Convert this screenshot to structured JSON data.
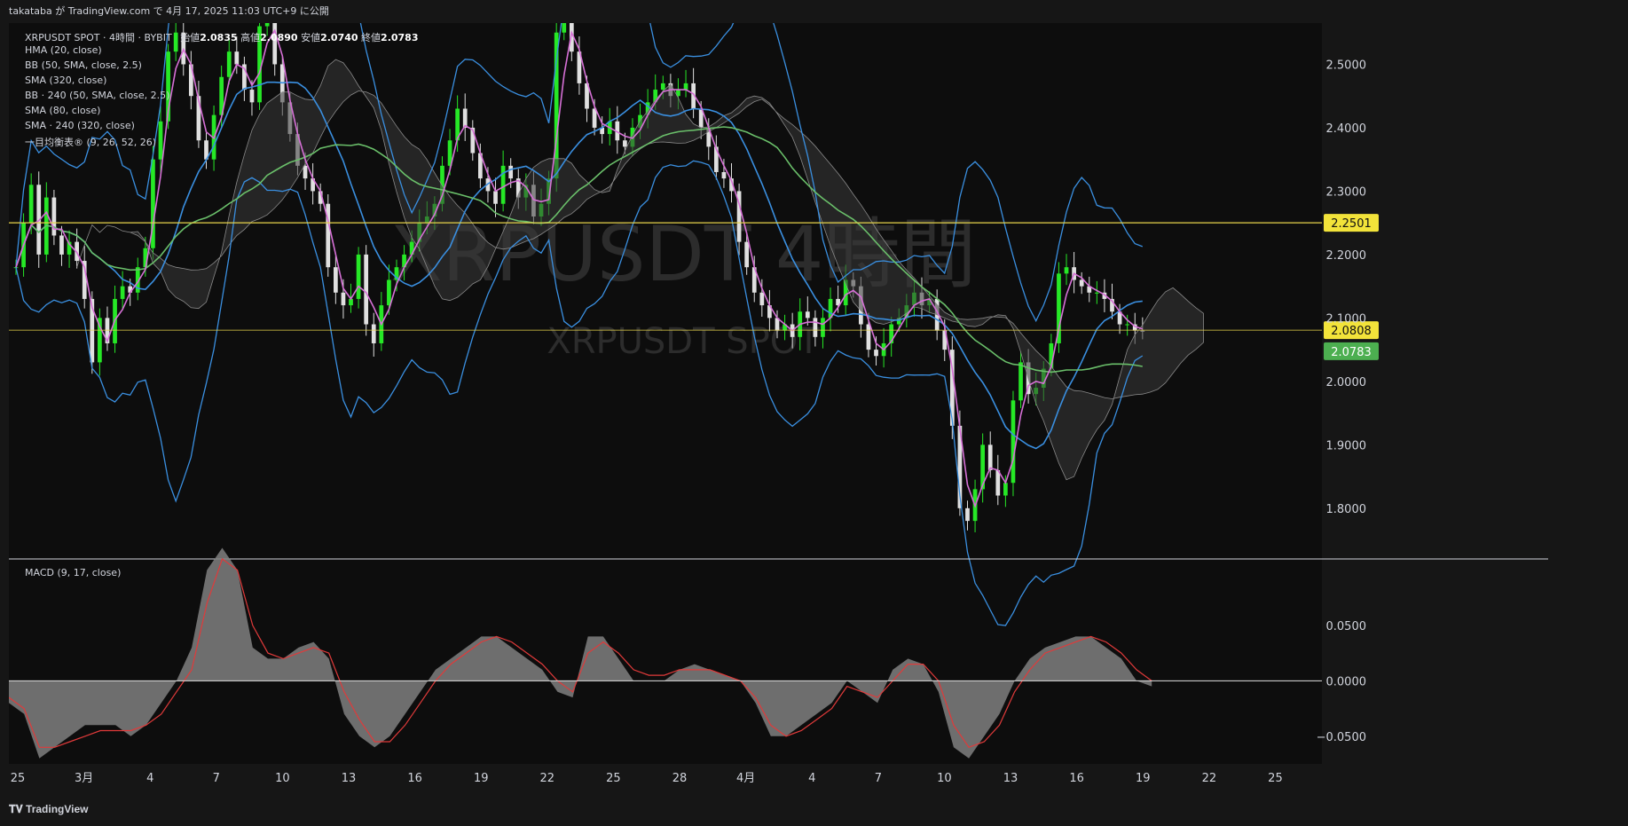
{
  "header": {
    "publish_text": "takataba が TradingView.com で 4月 17, 2025 11:03 UTC+9 に公開"
  },
  "legend": {
    "symbol_line": "XRPUSDT SPOT · 4時間 · BYBIT",
    "open_label": "始値",
    "open": "2.0835",
    "high_label": "高値",
    "high": "2.0890",
    "low_label": "安値",
    "low": "2.0740",
    "close_label": "終値",
    "close": "2.0783",
    "indicators": [
      "HMA (20, close)",
      "BB (50, SMA, close, 2.5)",
      "SMA (320, close)",
      "BB · 240 (50, SMA, close, 2.5)",
      "SMA (80, close)",
      "SMA · 240 (320, close)",
      "一目均衡表® (9, 26, 52, 26)"
    ],
    "macd": "MACD (9, 17, close)"
  },
  "watermark": {
    "big": "XRPUSDT 4時間",
    "small": "XRPUSDT SPOT"
  },
  "footer": {
    "brand": "TradingView"
  },
  "colors": {
    "up": "#26e826",
    "down": "#e0e0e0",
    "hma": "#d670d6",
    "bb": "#3a8fe0",
    "sma": "#6abf6a",
    "cloud": "#3a3a3a",
    "level": "#e6d34a",
    "macd_signal": "#e03a3a",
    "macd_hist": "#808080"
  },
  "chart_data": [
    {
      "type": "candlestick",
      "title": "XRPUSDT SPOT · 4時間 · BYBIT",
      "ylim": [
        1.72,
        2.565
      ],
      "y_ticks": [
        "2.5000",
        "2.4000",
        "2.3000",
        "2.2000",
        "2.1000",
        "2.0000",
        "1.9000",
        "1.8000"
      ],
      "x_ticks": [
        "25",
        "3月",
        "4",
        "7",
        "10",
        "13",
        "16",
        "19",
        "22",
        "25",
        "28",
        "4月",
        "4",
        "7",
        "10",
        "13",
        "16",
        "19",
        "22",
        "25"
      ],
      "horizontal_levels": [
        {
          "value": 2.2501,
          "label": "2.2501"
        },
        {
          "value": 2.0808,
          "label": "2.0808"
        }
      ],
      "last_price": {
        "value": 2.0783,
        "label": "2.0783"
      },
      "closes": [
        2.18,
        2.25,
        2.31,
        2.2,
        2.29,
        2.23,
        2.2,
        2.22,
        2.19,
        2.13,
        2.03,
        2.1,
        2.06,
        2.13,
        2.15,
        2.14,
        2.18,
        2.21,
        2.35,
        2.41,
        2.52,
        2.55,
        2.5,
        2.45,
        2.38,
        2.35,
        2.42,
        2.48,
        2.52,
        2.5,
        2.46,
        2.44,
        2.56,
        2.6,
        2.5,
        2.44,
        2.39,
        2.34,
        2.32,
        2.3,
        2.28,
        2.18,
        2.14,
        2.12,
        2.13,
        2.2,
        2.09,
        2.06,
        2.12,
        2.16,
        2.18,
        2.2,
        2.22,
        2.25,
        2.26,
        2.28,
        2.34,
        2.38,
        2.43,
        2.4,
        2.36,
        2.32,
        2.3,
        2.28,
        2.34,
        2.32,
        2.29,
        2.31,
        2.26,
        2.28,
        2.32,
        2.55,
        2.58,
        2.52,
        2.47,
        2.43,
        2.4,
        2.39,
        2.41,
        2.38,
        2.37,
        2.4,
        2.42,
        2.44,
        2.46,
        2.47,
        2.45,
        2.46,
        2.47,
        2.43,
        2.4,
        2.37,
        2.33,
        2.32,
        2.3,
        2.22,
        2.18,
        2.14,
        2.12,
        2.1,
        2.08,
        2.09,
        2.07,
        2.11,
        2.1,
        2.07,
        2.1,
        2.13,
        2.12,
        2.16,
        2.15,
        2.09,
        2.05,
        2.04,
        2.06,
        2.09,
        2.1,
        2.12,
        2.14,
        2.12,
        2.13,
        2.08,
        2.05,
        1.93,
        1.8,
        1.78,
        1.83,
        1.9,
        1.86,
        1.82,
        1.84,
        1.97,
        2.03,
        1.98,
        1.99,
        2.02,
        2.06,
        2.17,
        2.18,
        2.16,
        2.15,
        2.14,
        2.14,
        2.13,
        2.11,
        2.09,
        2.09,
        2.08,
        2.0783
      ],
      "series": [
        {
          "name": "MACD (9, 17, close)",
          "ylim": [
            -0.075,
            0.11
          ],
          "y_ticks": [
            "0.0500",
            "0.0000",
            "−0.0500"
          ],
          "macd": [
            -0.02,
            -0.03,
            -0.07,
            -0.06,
            -0.05,
            -0.04,
            -0.04,
            -0.04,
            -0.05,
            -0.04,
            -0.02,
            0.0,
            0.03,
            0.1,
            0.12,
            0.1,
            0.03,
            0.02,
            0.02,
            0.03,
            0.035,
            0.02,
            -0.03,
            -0.05,
            -0.06,
            -0.05,
            -0.03,
            -0.01,
            0.01,
            0.02,
            0.03,
            0.04,
            0.04,
            0.03,
            0.02,
            0.01,
            -0.01,
            -0.015,
            0.04,
            0.04,
            0.02,
            0.0,
            0.0,
            0.0,
            0.01,
            0.015,
            0.01,
            0.005,
            0.0,
            -0.02,
            -0.05,
            -0.05,
            -0.04,
            -0.03,
            -0.02,
            0.0,
            -0.01,
            -0.02,
            0.01,
            0.02,
            0.015,
            -0.01,
            -0.06,
            -0.07,
            -0.05,
            -0.03,
            0.0,
            0.02,
            0.03,
            0.035,
            0.04,
            0.04,
            0.03,
            0.02,
            0.0,
            -0.005
          ],
          "signal": [
            -0.015,
            -0.025,
            -0.06,
            -0.06,
            -0.055,
            -0.05,
            -0.045,
            -0.045,
            -0.045,
            -0.04,
            -0.03,
            -0.01,
            0.01,
            0.07,
            0.11,
            0.1,
            0.05,
            0.025,
            0.02,
            0.025,
            0.03,
            0.025,
            -0.01,
            -0.035,
            -0.055,
            -0.055,
            -0.04,
            -0.02,
            0.0,
            0.015,
            0.025,
            0.035,
            0.04,
            0.035,
            0.025,
            0.015,
            0.0,
            -0.01,
            0.025,
            0.035,
            0.025,
            0.01,
            0.005,
            0.005,
            0.01,
            0.01,
            0.01,
            0.005,
            0.0,
            -0.015,
            -0.04,
            -0.05,
            -0.045,
            -0.035,
            -0.025,
            -0.005,
            -0.01,
            -0.015,
            0.0,
            0.015,
            0.015,
            0.0,
            -0.04,
            -0.06,
            -0.055,
            -0.04,
            -0.01,
            0.01,
            0.025,
            0.03,
            0.035,
            0.04,
            0.035,
            0.025,
            0.01,
            0.0
          ]
        }
      ]
    }
  ]
}
